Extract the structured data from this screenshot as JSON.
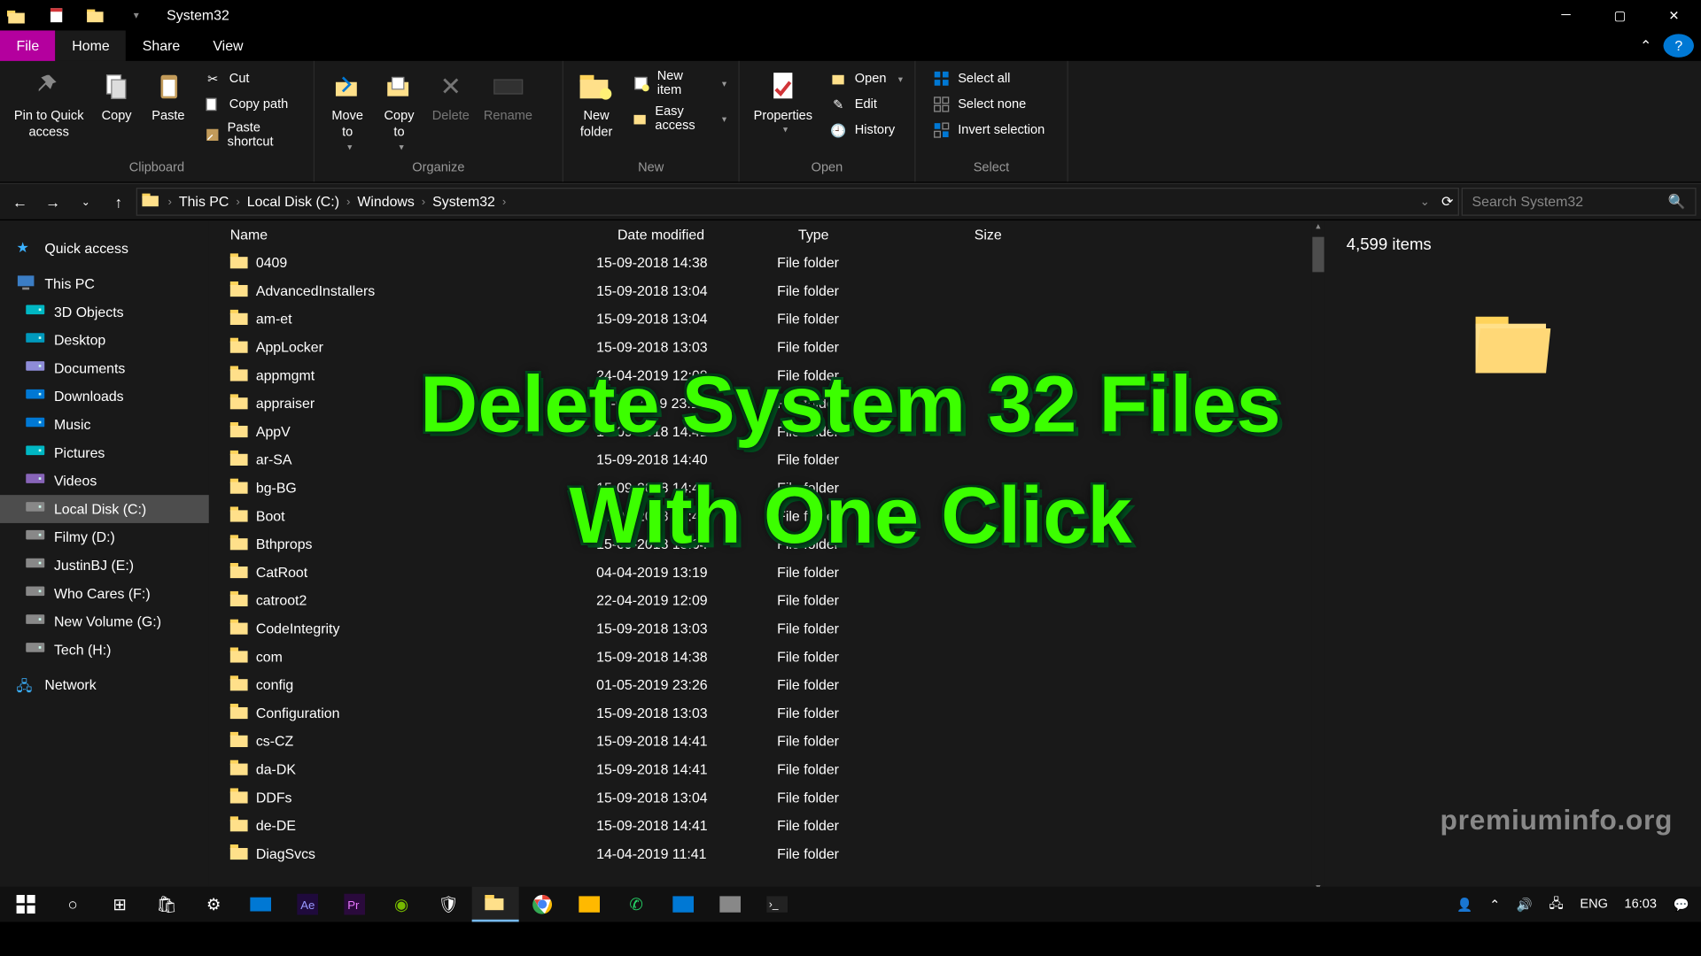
{
  "title": "System32",
  "tabs": {
    "file": "File",
    "home": "Home",
    "share": "Share",
    "view": "View"
  },
  "ribbon": {
    "clipboard": {
      "label": "Clipboard",
      "pin": "Pin to Quick\naccess",
      "copy": "Copy",
      "paste": "Paste",
      "cut": "Cut",
      "copypath": "Copy path",
      "pasteshortcut": "Paste shortcut"
    },
    "organize": {
      "label": "Organize",
      "moveto": "Move\nto",
      "copyto": "Copy\nto",
      "delete": "Delete",
      "rename": "Rename"
    },
    "new": {
      "label": "New",
      "newfolder": "New\nfolder",
      "newitem": "New item",
      "easyaccess": "Easy access"
    },
    "open": {
      "label": "Open",
      "properties": "Properties",
      "open": "Open",
      "edit": "Edit",
      "history": "History"
    },
    "select": {
      "label": "Select",
      "all": "Select all",
      "none": "Select none",
      "invert": "Invert selection"
    }
  },
  "breadcrumbs": [
    "This PC",
    "Local Disk (C:)",
    "Windows",
    "System32"
  ],
  "search_placeholder": "Search System32",
  "columns": {
    "name": "Name",
    "date": "Date modified",
    "type": "Type",
    "size": "Size"
  },
  "sidebar": {
    "quick": "Quick access",
    "thispc": "This PC",
    "items": [
      {
        "label": "3D Objects",
        "color": "#00b7c3"
      },
      {
        "label": "Desktop",
        "color": "#0099bc"
      },
      {
        "label": "Documents",
        "color": "#8e8cd8"
      },
      {
        "label": "Downloads",
        "color": "#0078d4"
      },
      {
        "label": "Music",
        "color": "#0078d4"
      },
      {
        "label": "Pictures",
        "color": "#00b7c3"
      },
      {
        "label": "Videos",
        "color": "#8764b8"
      },
      {
        "label": "Local Disk (C:)",
        "color": "#888",
        "sel": true
      },
      {
        "label": "Filmy (D:)",
        "color": "#888"
      },
      {
        "label": "JustinBJ (E:)",
        "color": "#888"
      },
      {
        "label": "Who Cares (F:)",
        "color": "#888"
      },
      {
        "label": "New Volume (G:)",
        "color": "#888"
      },
      {
        "label": "Tech (H:)",
        "color": "#888"
      }
    ],
    "network": "Network"
  },
  "files": [
    {
      "name": "0409",
      "date": "15-09-2018 14:38",
      "type": "File folder"
    },
    {
      "name": "AdvancedInstallers",
      "date": "15-09-2018 13:04",
      "type": "File folder"
    },
    {
      "name": "am-et",
      "date": "15-09-2018 13:04",
      "type": "File folder"
    },
    {
      "name": "AppLocker",
      "date": "15-09-2018 13:03",
      "type": "File folder"
    },
    {
      "name": "appmgmt",
      "date": "24-04-2019 12:08",
      "type": "File folder"
    },
    {
      "name": "appraiser",
      "date": "11-04-2019 23:14",
      "type": "File folder"
    },
    {
      "name": "AppV",
      "date": "15-09-2018 14:41",
      "type": "File folder"
    },
    {
      "name": "ar-SA",
      "date": "15-09-2018 14:40",
      "type": "File folder"
    },
    {
      "name": "bg-BG",
      "date": "15-09-2018 14:40",
      "type": "File folder"
    },
    {
      "name": "Boot",
      "date": "15-09-2018 14:41",
      "type": "File folder"
    },
    {
      "name": "Bthprops",
      "date": "15-09-2018 13:04",
      "type": "File folder"
    },
    {
      "name": "CatRoot",
      "date": "04-04-2019 13:19",
      "type": "File folder"
    },
    {
      "name": "catroot2",
      "date": "22-04-2019 12:09",
      "type": "File folder"
    },
    {
      "name": "CodeIntegrity",
      "date": "15-09-2018 13:03",
      "type": "File folder"
    },
    {
      "name": "com",
      "date": "15-09-2018 14:38",
      "type": "File folder"
    },
    {
      "name": "config",
      "date": "01-05-2019 23:26",
      "type": "File folder"
    },
    {
      "name": "Configuration",
      "date": "15-09-2018 13:03",
      "type": "File folder"
    },
    {
      "name": "cs-CZ",
      "date": "15-09-2018 14:41",
      "type": "File folder"
    },
    {
      "name": "da-DK",
      "date": "15-09-2018 14:41",
      "type": "File folder"
    },
    {
      "name": "DDFs",
      "date": "15-09-2018 13:04",
      "type": "File folder"
    },
    {
      "name": "de-DE",
      "date": "15-09-2018 14:41",
      "type": "File folder"
    },
    {
      "name": "DiagSvcs",
      "date": "14-04-2019 11:41",
      "type": "File folder"
    }
  ],
  "preview_count": "4,599 items",
  "status_count": "4,599 items",
  "overlay_text": "Delete System 32 Files\nWith One Click",
  "watermark": "premiuminfo.org",
  "tray": {
    "lang": "ENG",
    "time": "16:03"
  }
}
